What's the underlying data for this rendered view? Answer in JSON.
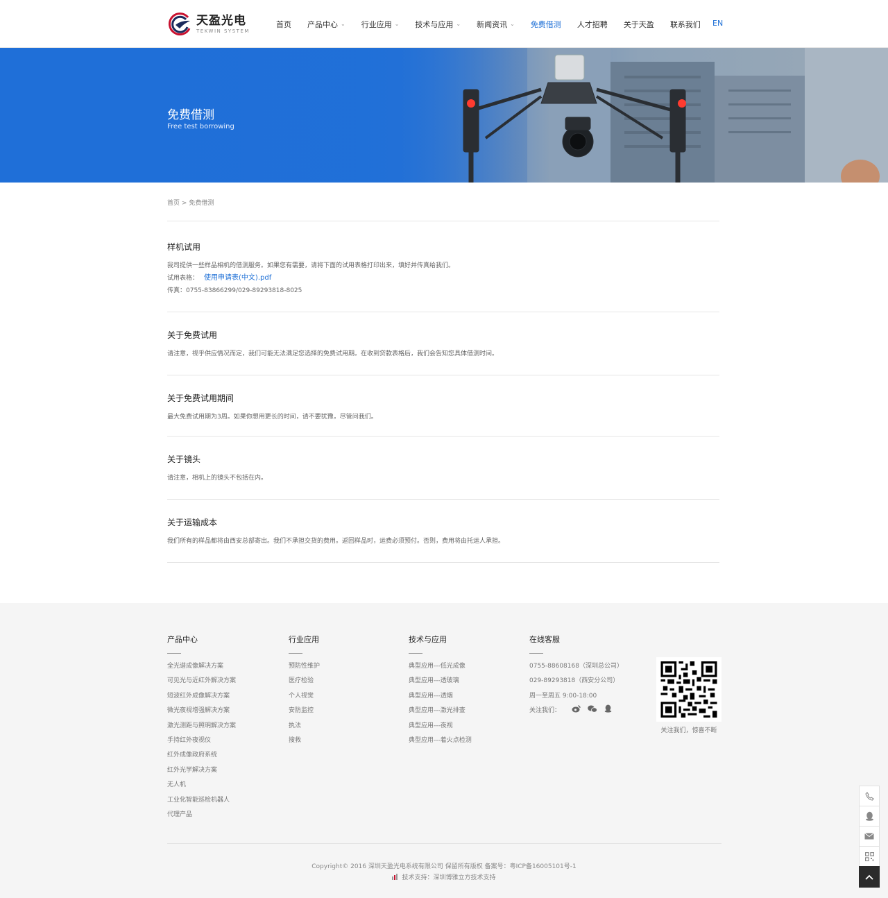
{
  "header": {
    "logo_cn": "天盈光电",
    "logo_en": "TEKWIN SYSTEM",
    "nav": [
      {
        "label": "首页",
        "dropdown": false,
        "active": false
      },
      {
        "label": "产品中心",
        "dropdown": true,
        "active": false
      },
      {
        "label": "行业应用",
        "dropdown": true,
        "active": false
      },
      {
        "label": "技术与应用",
        "dropdown": true,
        "active": false
      },
      {
        "label": "新闻资讯",
        "dropdown": true,
        "active": false
      },
      {
        "label": "免费借测",
        "dropdown": false,
        "active": true
      },
      {
        "label": "人才招聘",
        "dropdown": false,
        "active": false
      },
      {
        "label": "关于天盈",
        "dropdown": false,
        "active": false
      },
      {
        "label": "联系我们",
        "dropdown": false,
        "active": false
      }
    ],
    "lang": "EN"
  },
  "banner": {
    "title": "免费借测",
    "subtitle": "Free test borrowing"
  },
  "breadcrumb": {
    "home": "首页",
    "separator": ">",
    "current": "免费借测"
  },
  "sections": [
    {
      "title": "样机试用",
      "lines": [
        "我司提供一些样品相机的借测服务。如果您有需要，请将下面的试用表格打印出来，填好并传真给我们。"
      ],
      "form_label": "试用表格：",
      "form_link": "使用申请表(中文).pdf",
      "fax": "传真：0755-83866299/029-89293818-8025"
    },
    {
      "title": "关于免费试用",
      "lines": [
        "请注意，视乎供应情况而定，我们可能无法满足您选择的免费试用期。在收到贷款表格后，我们会告知您具体借测时间。"
      ]
    },
    {
      "title": "关于免费试用期间",
      "lines": [
        "最大免费试用期为3周。如果你想用更长的时间，请不要犹豫，尽管问我们。"
      ]
    },
    {
      "title": "关于镜头",
      "lines": [
        "请注意，相机上的镜头不包括在内。"
      ]
    },
    {
      "title": "关于运输成本",
      "lines": [
        "我们所有的样品都将由西安总部寄出。我们不承担交货的费用。返回样品时，运费必须预付。否则，费用将由托运人承担。"
      ]
    }
  ],
  "footer": {
    "columns": [
      {
        "title": "产品中心",
        "items": [
          "全光谱成像解决方案",
          "可见光与近红外解决方案",
          "短波红外成像解决方案",
          "微光夜视增强解决方案",
          "激光测距与照明解决方案",
          "手持红外夜视仪",
          "红外成像政府系统",
          "红外光学解决方案",
          "无人机",
          "工业化智能巡检机器人",
          "代理产品"
        ]
      },
      {
        "title": "行业应用",
        "items": [
          "预防性维护",
          "医疗检验",
          "个人视觉",
          "安防监控",
          "执法",
          "搜救"
        ]
      },
      {
        "title": "技术与应用",
        "items": [
          "典型应用---低光成像",
          "典型应用---透玻璃",
          "典型应用---透烟",
          "典型应用---激光排查",
          "典型应用---夜视",
          "典型应用---着火点检测"
        ]
      },
      {
        "title": "在线客服",
        "items": [
          "0755-88608168（深圳总公司）",
          "029-89293818（西安分公司）",
          "周一至周五 9:00-18:00"
        ],
        "follow_label": "关注我们：",
        "follow_icons": [
          "weibo-icon",
          "wechat-icon",
          "qq-icon"
        ]
      }
    ],
    "qr_caption": "关注我们，惊喜不断",
    "copyright": "Copyright© 2016 深圳天盈光电系统有限公司 保留所有版权 备案号：粤ICP备16005101号-1",
    "support": "技术支持：深圳博雅立方技术支持"
  },
  "side_toolbar": [
    "phone-icon",
    "qq-icon",
    "mail-icon",
    "qrcode-icon",
    "back-to-top-icon"
  ],
  "colors": {
    "accent": "#1d6fd6",
    "banner_blue": "#1f6fd8",
    "footer_bg": "#f5f5f5"
  }
}
